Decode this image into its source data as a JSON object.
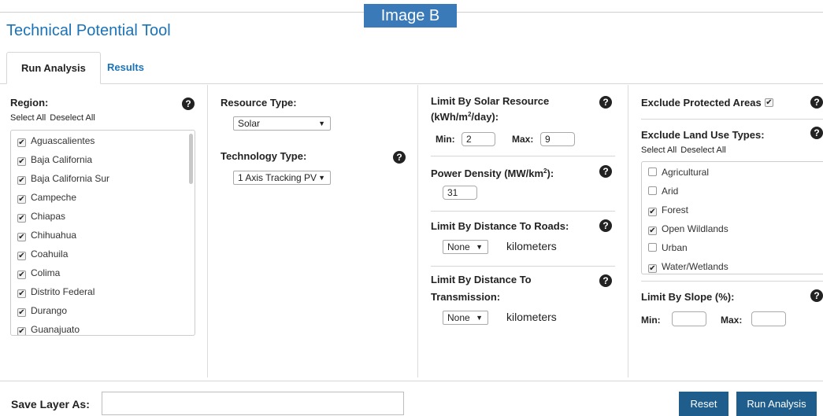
{
  "overlay_label": "Image B",
  "app_title": "Technical Potential Tool",
  "tabs": [
    {
      "label": "Run Analysis"
    },
    {
      "label": "Results"
    }
  ],
  "region": {
    "label": "Region:",
    "select_all": "Select All",
    "deselect_all": "Deselect All",
    "items": [
      {
        "name": "Aguascalientes",
        "checked": true
      },
      {
        "name": "Baja California",
        "checked": true
      },
      {
        "name": "Baja California Sur",
        "checked": true
      },
      {
        "name": "Campeche",
        "checked": true
      },
      {
        "name": "Chiapas",
        "checked": true
      },
      {
        "name": "Chihuahua",
        "checked": true
      },
      {
        "name": "Coahuila",
        "checked": true
      },
      {
        "name": "Colima",
        "checked": true
      },
      {
        "name": "Distrito Federal",
        "checked": true
      },
      {
        "name": "Durango",
        "checked": true
      },
      {
        "name": "Guanajuato",
        "checked": true
      }
    ]
  },
  "resource": {
    "label": "Resource Type:",
    "value": "Solar",
    "technology_label": "Technology Type:",
    "technology_value": "1 Axis Tracking PV"
  },
  "solar": {
    "label_line1": "Limit By Solar Resource",
    "label_line2_pre": "(kWh/m",
    "label_line2_sup": "2",
    "label_line2_post": "/day):",
    "min_label": "Min:",
    "min_value": "2",
    "max_label": "Max:",
    "max_value": "9"
  },
  "power_density": {
    "label_pre": "Power Density (MW/km",
    "label_sup": "2",
    "label_post": "):",
    "value": "31"
  },
  "roads": {
    "label": "Limit By Distance To Roads:",
    "value": "None",
    "unit": "kilometers"
  },
  "transmission": {
    "label_line1": "Limit By Distance To",
    "label_line2": "Transmission:",
    "value": "None",
    "unit": "kilometers"
  },
  "protected": {
    "label": "Exclude Protected Areas",
    "checked": true
  },
  "land_use": {
    "label": "Exclude Land Use Types:",
    "select_all": "Select All",
    "deselect_all": "Deselect All",
    "items": [
      {
        "name": "Agricultural",
        "checked": false
      },
      {
        "name": "Arid",
        "checked": false
      },
      {
        "name": "Forest",
        "checked": true
      },
      {
        "name": "Open Wildlands",
        "checked": true
      },
      {
        "name": "Urban",
        "checked": false
      },
      {
        "name": "Water/Wetlands",
        "checked": true
      }
    ]
  },
  "slope": {
    "label": "Limit By Slope (%):",
    "min_label": "Min:",
    "min_value": "",
    "max_label": "Max:",
    "max_value": ""
  },
  "footer": {
    "save_label": "Save Layer As:",
    "save_value": "",
    "reset_label": "Reset",
    "run_label": "Run Analysis"
  },
  "help_glyph": "?",
  "check_glyph": "✔",
  "arrow_glyph": "▼",
  "icons": {
    "help": "question-circle-icon",
    "checkbox": "checkbox-icon",
    "dropdown": "chevron-down-icon"
  },
  "colors": {
    "accent": "#1a73b8",
    "button": "#1f5e8c",
    "overlay_label_bg": "#3a7ab8"
  }
}
